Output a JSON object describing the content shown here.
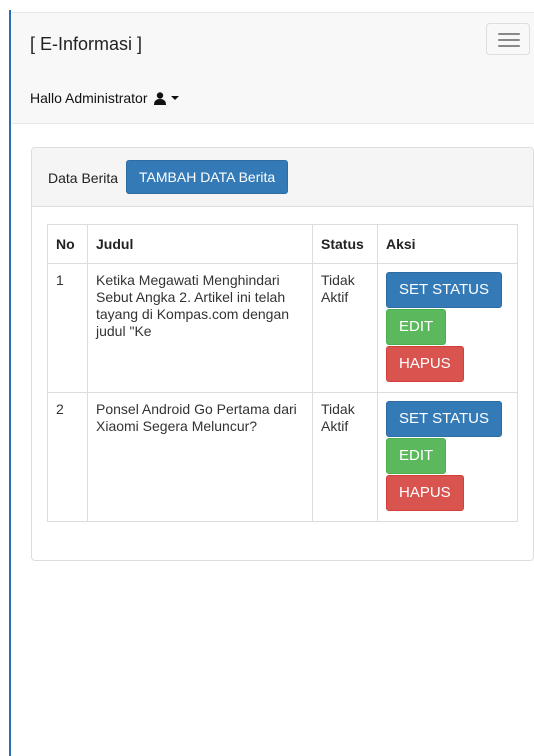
{
  "header": {
    "brand": "[ E-Informasi ]",
    "user_greeting": "Hallo Administrator"
  },
  "panel": {
    "title": "Data Berita",
    "add_button": "TAMBAH DATA Berita"
  },
  "table": {
    "columns": [
      "No",
      "Judul",
      "Status",
      "Aksi"
    ],
    "rows": [
      {
        "no": "1",
        "judul": "Ketika Megawati Menghindari Sebut Angka 2. Artikel ini telah tayang di Kompas.com dengan judul \"Ke",
        "status": "Tidak Aktif",
        "actions": [
          "SET STATUS",
          "EDIT",
          "HAPUS"
        ]
      },
      {
        "no": "2",
        "judul": "Ponsel Android Go Pertama dari Xiaomi Segera Meluncur?",
        "status": "Tidak Aktif",
        "actions": [
          "SET STATUS",
          "EDIT",
          "HAPUS"
        ]
      }
    ]
  },
  "icons": {
    "menu": "hamburger-icon",
    "user": "user-icon",
    "dropdown": "caret-down-icon"
  },
  "colors": {
    "primary": "#337ab7",
    "success": "#5cb85c",
    "danger": "#d9534f"
  }
}
